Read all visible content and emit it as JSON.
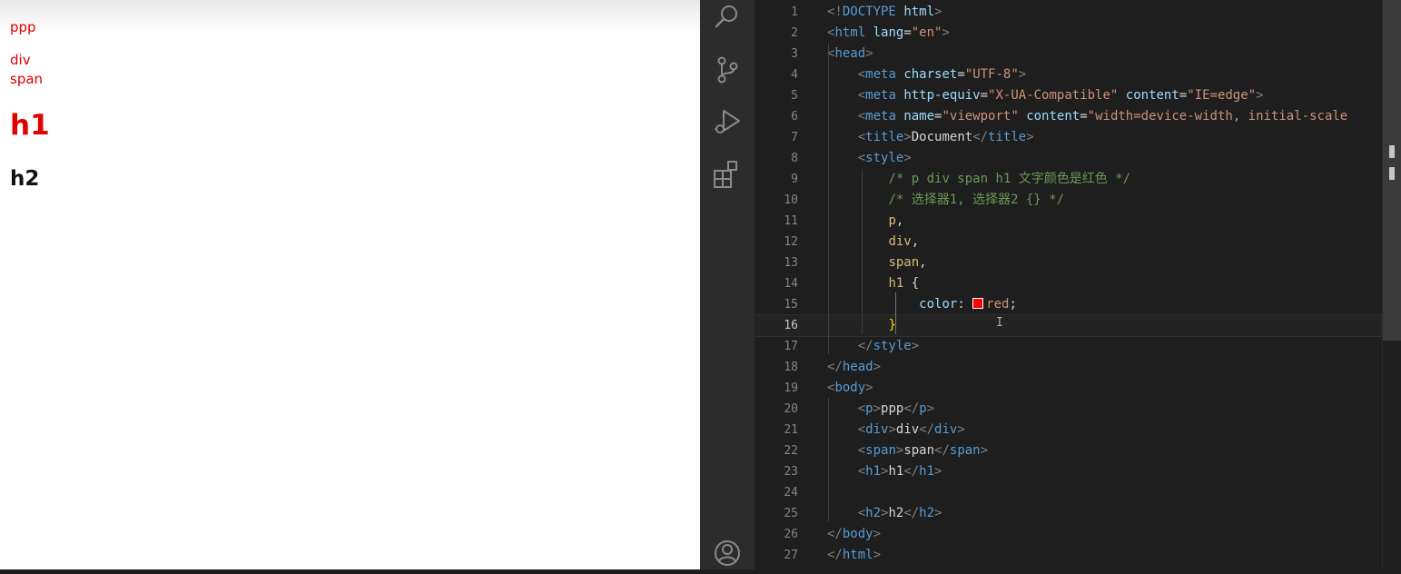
{
  "preview": {
    "p_text": "ppp",
    "div_text": "div",
    "span_text": "span",
    "h1_text": "h1",
    "h2_text": "h2",
    "accent_color": "#e00000"
  },
  "activity_bar": {
    "icons": [
      "search-icon",
      "source-control-icon",
      "run-debug-icon",
      "extensions-icon",
      "account-icon"
    ]
  },
  "editor": {
    "current_line": 16,
    "colors": {
      "swatch_red": "#ff0000",
      "keyword": "#569cd6",
      "string": "#ce9178",
      "comment": "#6a9955"
    },
    "lines": [
      {
        "n": "1",
        "t": [
          [
            "t-bracket",
            "<!"
          ],
          [
            "t-tag",
            "DOCTYPE"
          ],
          [
            "t-text",
            " "
          ],
          [
            "t-attr",
            "html"
          ],
          [
            "t-bracket",
            ">"
          ]
        ]
      },
      {
        "n": "2",
        "t": [
          [
            "t-bracket",
            "<"
          ],
          [
            "t-tag",
            "html"
          ],
          [
            "t-text",
            " "
          ],
          [
            "t-attr",
            "lang"
          ],
          [
            "t-punct",
            "="
          ],
          [
            "t-str",
            "\"en\""
          ],
          [
            "t-bracket",
            ">"
          ]
        ]
      },
      {
        "n": "3",
        "t": [
          [
            "t-bracket",
            "<"
          ],
          [
            "t-tag",
            "head"
          ],
          [
            "t-bracket",
            ">"
          ]
        ]
      },
      {
        "n": "4",
        "t": [
          [
            "t-text",
            "    "
          ],
          [
            "t-bracket",
            "<"
          ],
          [
            "t-tag",
            "meta"
          ],
          [
            "t-text",
            " "
          ],
          [
            "t-attr",
            "charset"
          ],
          [
            "t-punct",
            "="
          ],
          [
            "t-str",
            "\"UTF-8\""
          ],
          [
            "t-bracket",
            ">"
          ]
        ]
      },
      {
        "n": "5",
        "t": [
          [
            "t-text",
            "    "
          ],
          [
            "t-bracket",
            "<"
          ],
          [
            "t-tag",
            "meta"
          ],
          [
            "t-text",
            " "
          ],
          [
            "t-attr",
            "http-equiv"
          ],
          [
            "t-punct",
            "="
          ],
          [
            "t-str",
            "\"X-UA-Compatible\""
          ],
          [
            "t-text",
            " "
          ],
          [
            "t-attr",
            "content"
          ],
          [
            "t-punct",
            "="
          ],
          [
            "t-str",
            "\"IE=edge\""
          ],
          [
            "t-bracket",
            ">"
          ]
        ]
      },
      {
        "n": "6",
        "t": [
          [
            "t-text",
            "    "
          ],
          [
            "t-bracket",
            "<"
          ],
          [
            "t-tag",
            "meta"
          ],
          [
            "t-text",
            " "
          ],
          [
            "t-attr",
            "name"
          ],
          [
            "t-punct",
            "="
          ],
          [
            "t-str",
            "\"viewport\""
          ],
          [
            "t-text",
            " "
          ],
          [
            "t-attr",
            "content"
          ],
          [
            "t-punct",
            "="
          ],
          [
            "t-str",
            "\"width=device-width, initial-scale"
          ]
        ]
      },
      {
        "n": "7",
        "t": [
          [
            "t-text",
            "    "
          ],
          [
            "t-bracket",
            "<"
          ],
          [
            "t-tag",
            "title"
          ],
          [
            "t-bracket",
            ">"
          ],
          [
            "t-text",
            "Document"
          ],
          [
            "t-bracket",
            "</"
          ],
          [
            "t-tag",
            "title"
          ],
          [
            "t-bracket",
            ">"
          ]
        ]
      },
      {
        "n": "8",
        "t": [
          [
            "t-text",
            "    "
          ],
          [
            "t-bracket",
            "<"
          ],
          [
            "t-tag",
            "style"
          ],
          [
            "t-bracket",
            ">"
          ]
        ]
      },
      {
        "n": "9",
        "t": [
          [
            "t-text",
            "        "
          ],
          [
            "t-comment",
            "/* p div span h1 文字颜色是红色 */"
          ]
        ]
      },
      {
        "n": "10",
        "t": [
          [
            "t-text",
            "        "
          ],
          [
            "t-comment",
            "/* 选择器1, 选择器2 {} */"
          ]
        ]
      },
      {
        "n": "11",
        "t": [
          [
            "t-text",
            "        "
          ],
          [
            "t-sel",
            "p"
          ],
          [
            "t-punct",
            ","
          ]
        ]
      },
      {
        "n": "12",
        "t": [
          [
            "t-text",
            "        "
          ],
          [
            "t-sel",
            "div"
          ],
          [
            "t-punct",
            ","
          ]
        ]
      },
      {
        "n": "13",
        "t": [
          [
            "t-text",
            "        "
          ],
          [
            "t-sel",
            "span"
          ],
          [
            "t-punct",
            ","
          ]
        ]
      },
      {
        "n": "14",
        "t": [
          [
            "t-text",
            "        "
          ],
          [
            "t-sel",
            "h1"
          ],
          [
            "t-text",
            " "
          ],
          [
            "t-punct",
            "{"
          ]
        ]
      },
      {
        "n": "15",
        "t": [
          [
            "t-text",
            "            "
          ],
          [
            "t-prop",
            "color"
          ],
          [
            "t-punct",
            ": "
          ],
          [
            "swatch",
            ""
          ],
          [
            "t-val",
            "red"
          ],
          [
            "t-punct",
            ";"
          ]
        ]
      },
      {
        "n": "16",
        "t": [
          [
            "t-text",
            "        "
          ],
          [
            "t-brace",
            "}"
          ]
        ]
      },
      {
        "n": "17",
        "t": [
          [
            "t-text",
            "    "
          ],
          [
            "t-bracket",
            "</"
          ],
          [
            "t-tag",
            "style"
          ],
          [
            "t-bracket",
            ">"
          ]
        ]
      },
      {
        "n": "18",
        "t": [
          [
            "t-bracket",
            "</"
          ],
          [
            "t-tag",
            "head"
          ],
          [
            "t-bracket",
            ">"
          ]
        ]
      },
      {
        "n": "19",
        "t": [
          [
            "t-bracket",
            "<"
          ],
          [
            "t-tag",
            "body"
          ],
          [
            "t-bracket",
            ">"
          ]
        ]
      },
      {
        "n": "20",
        "t": [
          [
            "t-text",
            "    "
          ],
          [
            "t-bracket",
            "<"
          ],
          [
            "t-tag",
            "p"
          ],
          [
            "t-bracket",
            ">"
          ],
          [
            "t-text",
            "ppp"
          ],
          [
            "t-bracket",
            "</"
          ],
          [
            "t-tag",
            "p"
          ],
          [
            "t-bracket",
            ">"
          ]
        ]
      },
      {
        "n": "21",
        "t": [
          [
            "t-text",
            "    "
          ],
          [
            "t-bracket",
            "<"
          ],
          [
            "t-tag",
            "div"
          ],
          [
            "t-bracket",
            ">"
          ],
          [
            "t-text",
            "div"
          ],
          [
            "t-bracket",
            "</"
          ],
          [
            "t-tag",
            "div"
          ],
          [
            "t-bracket",
            ">"
          ]
        ]
      },
      {
        "n": "22",
        "t": [
          [
            "t-text",
            "    "
          ],
          [
            "t-bracket",
            "<"
          ],
          [
            "t-tag",
            "span"
          ],
          [
            "t-bracket",
            ">"
          ],
          [
            "t-text",
            "span"
          ],
          [
            "t-bracket",
            "</"
          ],
          [
            "t-tag",
            "span"
          ],
          [
            "t-bracket",
            ">"
          ]
        ]
      },
      {
        "n": "23",
        "t": [
          [
            "t-text",
            "    "
          ],
          [
            "t-bracket",
            "<"
          ],
          [
            "t-tag",
            "h1"
          ],
          [
            "t-bracket",
            ">"
          ],
          [
            "t-text",
            "h1"
          ],
          [
            "t-bracket",
            "</"
          ],
          [
            "t-tag",
            "h1"
          ],
          [
            "t-bracket",
            ">"
          ]
        ]
      },
      {
        "n": "24",
        "t": []
      },
      {
        "n": "25",
        "t": [
          [
            "t-text",
            "    "
          ],
          [
            "t-bracket",
            "<"
          ],
          [
            "t-tag",
            "h2"
          ],
          [
            "t-bracket",
            ">"
          ],
          [
            "t-text",
            "h2"
          ],
          [
            "t-bracket",
            "</"
          ],
          [
            "t-tag",
            "h2"
          ],
          [
            "t-bracket",
            ">"
          ]
        ]
      },
      {
        "n": "26",
        "t": [
          [
            "t-bracket",
            "</"
          ],
          [
            "t-tag",
            "body"
          ],
          [
            "t-bracket",
            ">"
          ]
        ]
      },
      {
        "n": "27",
        "t": [
          [
            "t-bracket",
            "</"
          ],
          [
            "t-tag",
            "html"
          ],
          [
            "t-bracket",
            ">"
          ]
        ]
      }
    ]
  }
}
